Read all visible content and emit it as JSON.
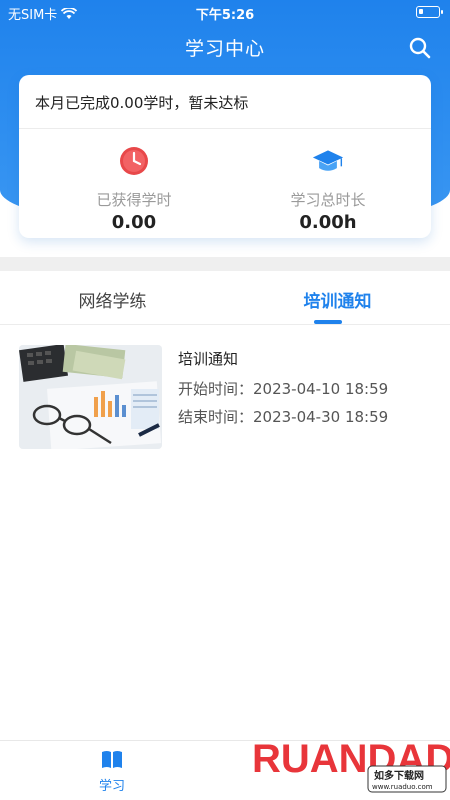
{
  "status_bar": {
    "carrier": "无SIM卡",
    "time": "下午5:26"
  },
  "nav": {
    "title": "学习中心"
  },
  "summary": {
    "text": "本月已完成0.00学时，暂未达标",
    "stats": [
      {
        "label": "已获得学时",
        "value": "0.00",
        "icon": "clock-icon"
      },
      {
        "label": "学习总时长",
        "value": "0.00h",
        "icon": "graduation-cap-icon"
      }
    ]
  },
  "tabs": [
    {
      "label": "网络学练",
      "active": false
    },
    {
      "label": "培训通知",
      "active": true
    }
  ],
  "notices": [
    {
      "title": "培训通知",
      "start": "开始时间：2023-04-10 18:59",
      "end": "结束时间：2023-04-30 18:59"
    }
  ],
  "bottom_nav": [
    {
      "label": "学习",
      "icon": "book-icon",
      "active": true
    }
  ],
  "watermark": {
    "brand": "RUANDADO",
    "sub": "如多下载网",
    "url": "www.ruaduo.com"
  },
  "colors": {
    "accent": "#1f82ec",
    "clock": "#e8484a"
  }
}
